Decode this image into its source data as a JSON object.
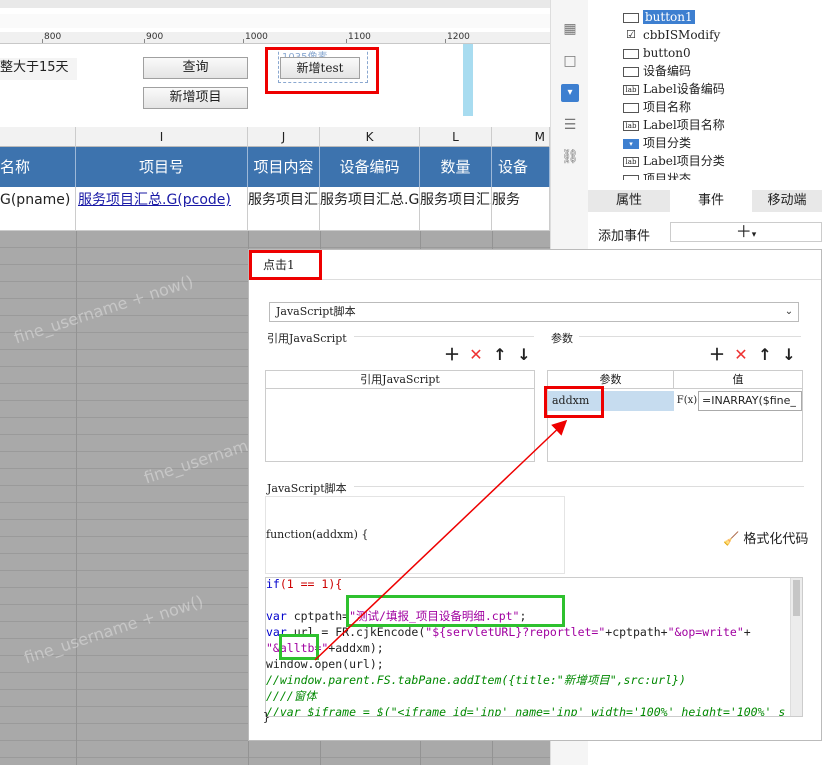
{
  "ruler": {
    "labels": [
      "800",
      "900",
      "1000",
      "1100",
      "1200"
    ]
  },
  "form": {
    "filter_label": "整大于15天",
    "query_button": "查询",
    "add_test_button": "新增test",
    "add_test_hint": "1035像素",
    "add_item_button": "新增项目"
  },
  "sheet": {
    "columns": [
      "I",
      "J",
      "K",
      "L",
      "M"
    ],
    "headers": [
      "名称",
      "项目号",
      "项目内容",
      "设备编码",
      "数量",
      "设备"
    ],
    "row1": [
      "G(pname)",
      "服务项目汇总.G(pcode)",
      "服务项目汇总.G(",
      "服务项目汇总.G(pcode)",
      "服务项目汇总.G(",
      "服务"
    ],
    "watermark": "fine_username + now()"
  },
  "tree": {
    "items": [
      {
        "icon": "button",
        "label": "button1",
        "selected": true
      },
      {
        "icon": "checkbox",
        "label": "cbbISModify"
      },
      {
        "icon": "button",
        "label": "button0"
      },
      {
        "icon": "textfield",
        "label": "设备编码"
      },
      {
        "icon": "label",
        "label": "Label设备编码"
      },
      {
        "icon": "textfield",
        "label": "项目名称"
      },
      {
        "icon": "label",
        "label": "Label项目名称"
      },
      {
        "icon": "combo",
        "label": "项目分类"
      },
      {
        "icon": "label",
        "label": "Label项目分类"
      },
      {
        "icon": "textfield",
        "label": "项目状态"
      }
    ]
  },
  "prop_tabs": [
    "属性",
    "事件",
    "移动端"
  ],
  "add_event_label": "添加事件",
  "dialog": {
    "tab": "点击1",
    "type_select": "JavaScript脚本",
    "ref_js_label": "引用JavaScript",
    "ref_js_header": "引用JavaScript",
    "params_label": "参数",
    "param_col": "参数",
    "value_col": "值",
    "param_name": "addxm",
    "param_fx": "F(x)",
    "param_value": "=INARRAY($fine_",
    "script_label": "JavaScript脚本",
    "function_sig": "function(addxm) {",
    "format_code": "格式化代码",
    "code": {
      "l1_kw": "if",
      "l1_rest": "(1 == 1){",
      "l3_kw": "var",
      "l3_a": " cptpath=",
      "l3_str": "\"测试/填报_项目设备明细.cpt\"",
      "l3_end": ";",
      "l4_kw": "var",
      "l4_a": " url = FR.cjkEncode(",
      "l4_str": "\"${servletURL}?reportlet=\"",
      "l4_b": "+cptpath+",
      "l4_str2": "\"&op=write\"",
      "l4_c": "+",
      "l5_str": "\"&alltb=\"",
      "l5_rest": "+addxm);",
      "l6": "window.open(url);",
      "l7": "//window.parent.FS.tabPane.addItem({title:\"新增项目\",src:url})",
      "l8": "////窗体",
      "l9": "//var $iframe = $(\"<iframe id='inp' name='inp' width='100%' height='100%' s",
      "l10": "}"
    }
  }
}
